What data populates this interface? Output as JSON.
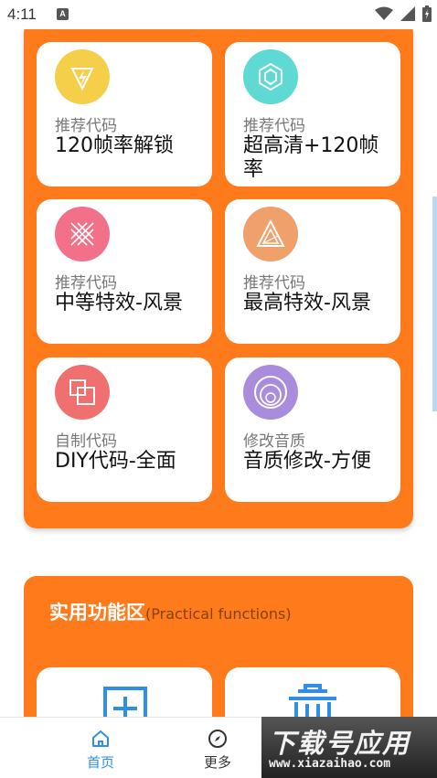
{
  "status_bar": {
    "time": "4:11",
    "notification_letter": "A"
  },
  "code_cards": [
    {
      "subtitle": "推荐代码",
      "title": "120帧率解锁",
      "icon": "lightning-icon",
      "icon_color": "#f5cf4a"
    },
    {
      "subtitle": "推荐代码",
      "title": "超高清+120帧率",
      "icon": "hexagon-icon",
      "icon_color": "#5fd9d3"
    },
    {
      "subtitle": "推荐代码",
      "title": "中等特效-风景",
      "icon": "cross-lines-icon",
      "icon_color": "#f2708a"
    },
    {
      "subtitle": "推荐代码",
      "title": "最高特效-风景",
      "icon": "triangle-icon",
      "icon_color": "#f0a06b"
    },
    {
      "subtitle": "自制代码",
      "title": "DIY代码-全面",
      "icon": "squares-icon",
      "icon_color": "#f06f6f"
    },
    {
      "subtitle": "修改音质",
      "title": "音质修改-方便",
      "icon": "circles-icon",
      "icon_color": "#a98ddc"
    }
  ],
  "practical": {
    "title": "实用功能区",
    "subtitle": "(Practical functions)"
  },
  "bottom_nav": {
    "home_label": "首页",
    "more_label": "更多"
  },
  "watermark": {
    "top": "下载号应用",
    "bottom": "www.xiazaihao.com"
  },
  "colors": {
    "accent": "#ff7a1a",
    "nav_active": "#2f8fe6",
    "func_icon": "#2f8fe6"
  }
}
